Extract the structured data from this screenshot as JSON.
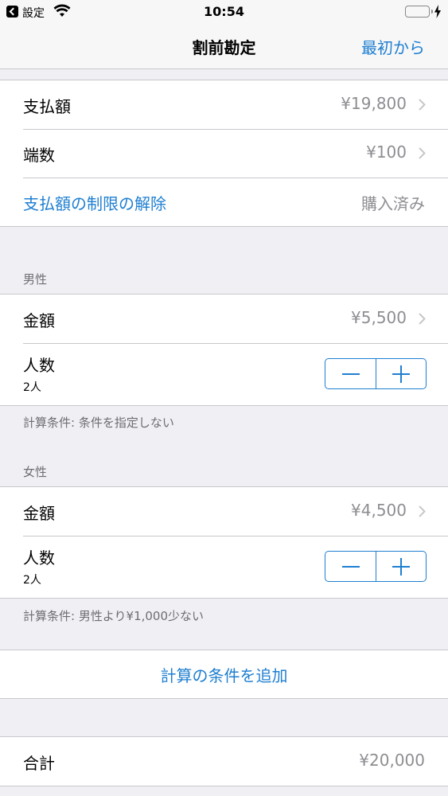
{
  "status_bar": {
    "back_label": "設定",
    "time": "10:54",
    "battery_color": "#4cd964"
  },
  "nav": {
    "title": "割前勘定",
    "right_button": "最初から"
  },
  "summary": {
    "payment_label": "支払額",
    "payment_value": "¥19,800",
    "fraction_label": "端数",
    "fraction_value": "¥100",
    "unlock_label": "支払額の制限の解除",
    "unlock_status": "購入済み"
  },
  "groups": [
    {
      "header": "男性",
      "amount_label": "金額",
      "amount_value": "¥5,500",
      "people_label": "人数",
      "people_count": "2人",
      "footer": "計算条件: 条件を指定しない"
    },
    {
      "header": "女性",
      "amount_label": "金額",
      "amount_value": "¥4,500",
      "people_label": "人数",
      "people_count": "2人",
      "footer": "計算条件: 男性より¥1,000少ない"
    }
  ],
  "add_condition_label": "計算の条件を追加",
  "total": {
    "label": "合計",
    "value": "¥20,000"
  },
  "icons": {
    "back": "back-to-app-icon",
    "wifi": "wifi-icon",
    "battery": "battery-icon",
    "charging": "bolt-icon",
    "chevron": "chevron-right-icon",
    "minus": "minus-icon",
    "plus": "plus-icon"
  },
  "accent_color": "#1f7fd1"
}
